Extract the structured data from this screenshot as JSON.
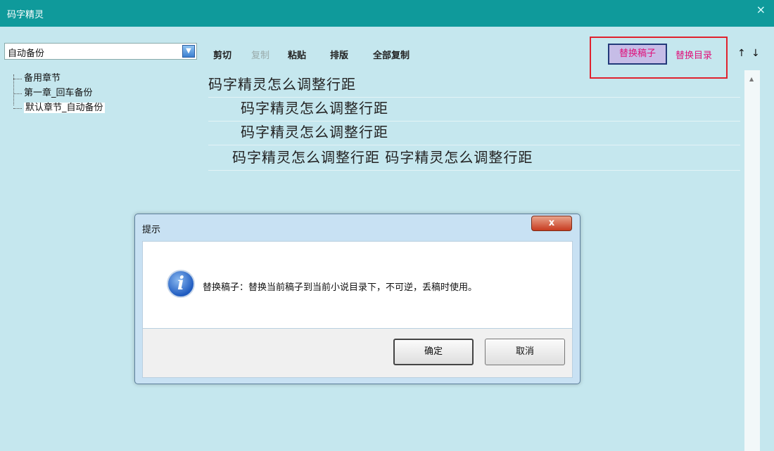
{
  "window": {
    "title": "码字精灵",
    "close_glyph": "×"
  },
  "backup_select": {
    "value": "自动备份"
  },
  "tree": {
    "items": [
      {
        "label": "备用章节"
      },
      {
        "label": "第一章_回车备份"
      },
      {
        "label": "默认章节_自动备份"
      }
    ]
  },
  "toolbar": {
    "cut": "剪切",
    "copy": "复制",
    "paste": "粘贴",
    "layout": "排版",
    "copy_all": "全部复制",
    "replace_draft": "替换稿子",
    "replace_directory": "替换目录",
    "up": "↑",
    "down": "↓"
  },
  "editor": {
    "lines": [
      "码字精灵怎么调整行距",
      "码字精灵怎么调整行距",
      "码字精灵怎么调整行距",
      "码字精灵怎么调整行距 码字精灵怎么调整行距"
    ]
  },
  "dialog": {
    "title": "提示",
    "close_glyph": "x",
    "message": "替换稿子：替换当前稿子到当前小说目录下，不可逆，丢稿时使用。",
    "ok": "确定",
    "cancel": "取消",
    "icon": "info-icon"
  },
  "colors": {
    "titlebar": "#0f9a9b",
    "background": "#c5e7ee",
    "highlight_text": "#e0107a",
    "red_box": "#e0222e"
  }
}
